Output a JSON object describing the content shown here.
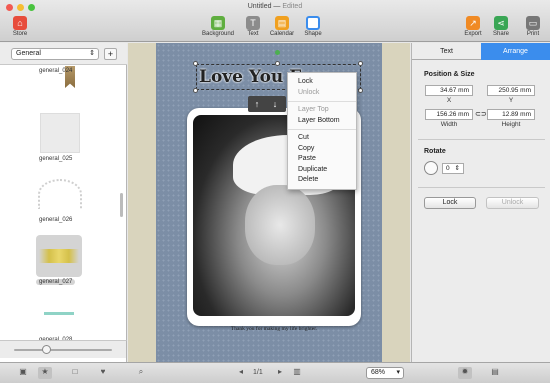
{
  "window": {
    "title": "Untitled",
    "status": "Edited"
  },
  "toolbar": {
    "store": "Store",
    "background": "Background",
    "text": "Text",
    "calendar": "Calendar",
    "shape": "Shape",
    "export": "Export",
    "share": "Share",
    "print": "Print"
  },
  "sidebar": {
    "category": "General",
    "add_symbol": "+",
    "items": [
      {
        "label": "general_024"
      },
      {
        "label": "general_025"
      },
      {
        "label": "general_026"
      },
      {
        "label": "general_027"
      },
      {
        "label": "general_028"
      }
    ]
  },
  "canvas": {
    "heading": "Love You Fore",
    "caption": "Thank you for making my life brighter.",
    "page_indicator": "1/1",
    "zoom": "68%"
  },
  "context_menu": {
    "items": [
      "Lock",
      "Unlock",
      "Layer Top",
      "Layer Bottom",
      "Cut",
      "Copy",
      "Paste",
      "Duplicate",
      "Delete"
    ]
  },
  "inspector": {
    "tab_text": "Text",
    "tab_arrange": "Arrange",
    "position_size_title": "Position & Size",
    "x_value": "34.67 mm",
    "y_value": "250.95 mm",
    "width_value": "156.26 mm",
    "height_value": "12.89 mm",
    "x_label": "X",
    "y_label": "Y",
    "width_label": "Width",
    "height_label": "Height",
    "rotate_title": "Rotate",
    "rotate_value": "0",
    "lock_button": "Lock",
    "unlock_button": "Unlock"
  },
  "colors": {
    "accent": "#3b8ded",
    "page_bg": "#7c8ea6",
    "canvas_bg": "#d9d4bd"
  }
}
